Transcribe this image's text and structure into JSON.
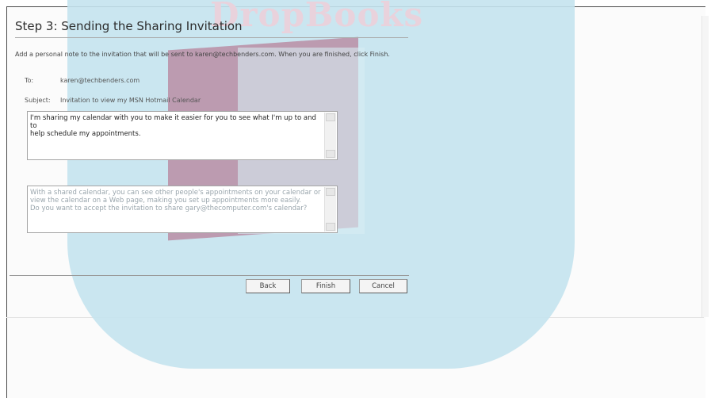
{
  "watermark": {
    "text": "DropBooks"
  },
  "step": {
    "title": "Step 3: Sending the Sharing Invitation",
    "intro": "Add a personal note to the invitation that will be sent to karen@techbenders.com. When you are finished, click Finish."
  },
  "invite": {
    "to_label": "To:",
    "to_value": "karen@techbenders.com",
    "subject_label": "Subject:",
    "subject_value": "Invitation to view my MSN Hotmail Calendar",
    "note_line1": "I'm sharing my calendar with you to make it easier for you to see what I'm up to and to",
    "note_line2": "help schedule my appointments.",
    "info_line1": "With a shared calendar, you can see other people's appointments on your calendar or",
    "info_line2": "view the calendar on a Web page, making you set up appointments more easily.",
    "info_line3": "Do you want to accept the invitation to share gary@thecomputer.com's calendar?"
  },
  "buttons": {
    "back": "Back",
    "finish": "Finish",
    "cancel": "Cancel"
  }
}
